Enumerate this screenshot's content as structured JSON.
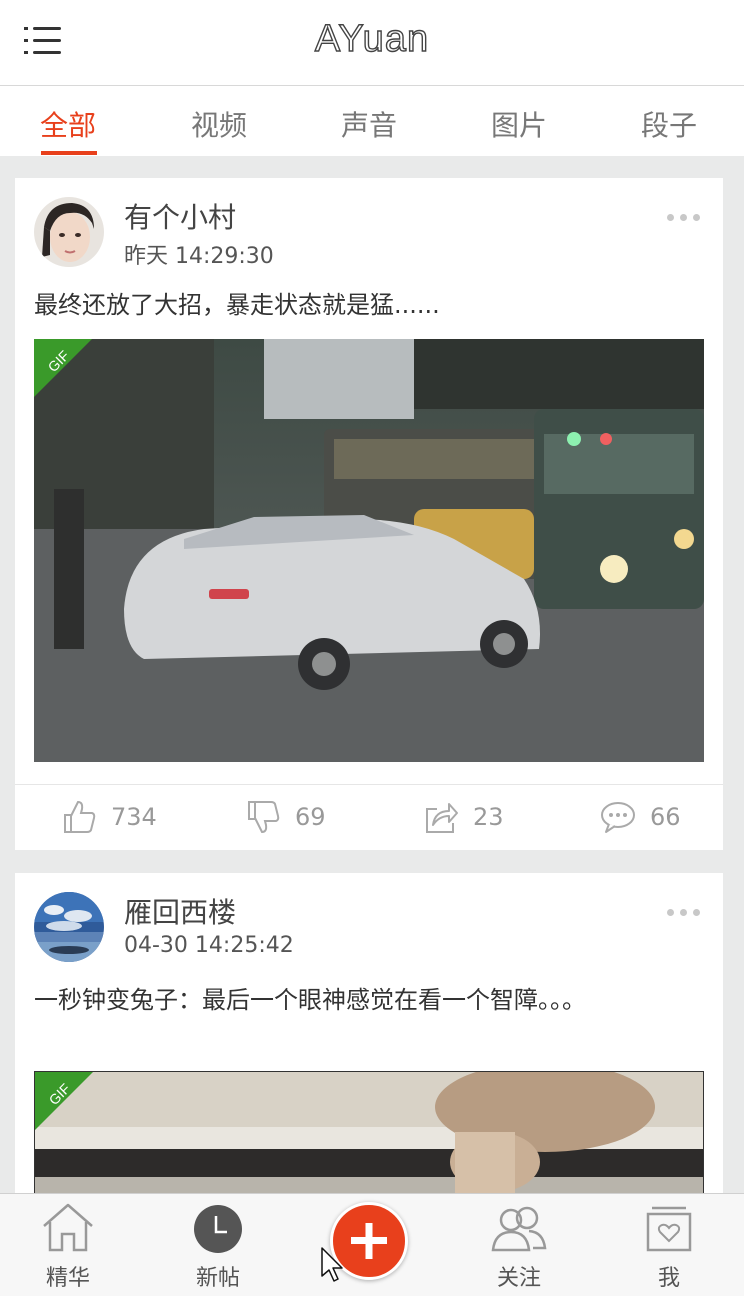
{
  "app": {
    "title": "AYuan"
  },
  "tabs": [
    {
      "label": "全部"
    },
    {
      "label": "视频"
    },
    {
      "label": "声音"
    },
    {
      "label": "图片"
    },
    {
      "label": "段子"
    }
  ],
  "posts": [
    {
      "user": "有个小村",
      "time": "昨天 14:29:30",
      "text": "最终还放了大招，暴走状态就是猛......",
      "badge": "GIF",
      "likes": "734",
      "dislikes": "69",
      "shares": "23",
      "comments": "66"
    },
    {
      "user": "雁回西楼",
      "time": "04-30 14:25:42",
      "text": "一秒钟变兔子：最后一个眼神感觉在看一个智障。。。",
      "badge": "GIF"
    }
  ],
  "bottom_nav": [
    {
      "label": "精华"
    },
    {
      "label": "新帖"
    },
    {
      "label": "关注"
    },
    {
      "label": "我"
    }
  ],
  "colors": {
    "accent": "#e8401c",
    "gif_badge": "#3a9a2a"
  }
}
